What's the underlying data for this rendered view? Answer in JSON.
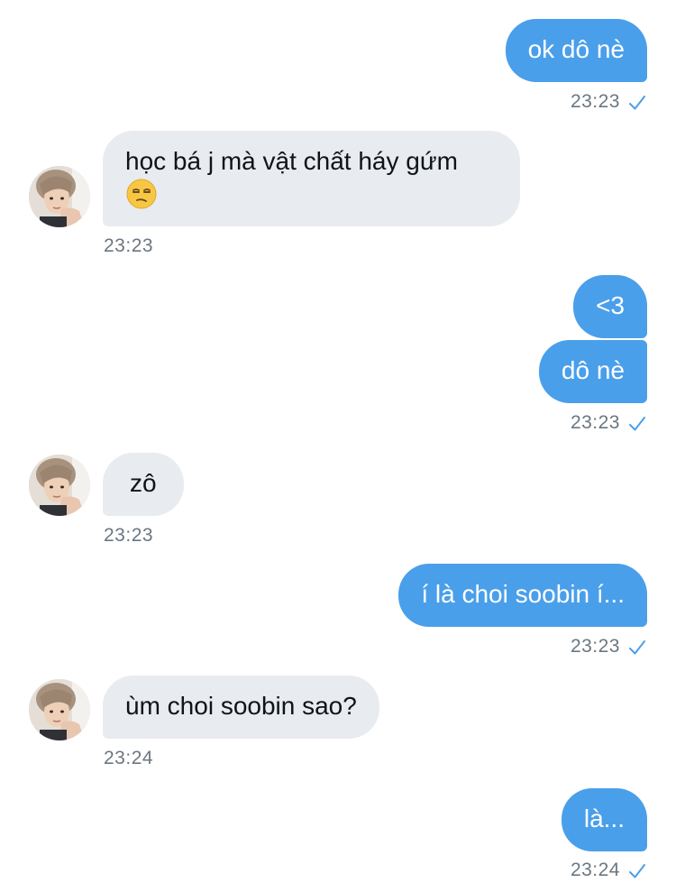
{
  "colors": {
    "outgoing_bubble": "#4a9fea",
    "incoming_bubble": "#e8ebef",
    "timestamp": "#6b7780",
    "read_check": "#4a9fea"
  },
  "messages": [
    {
      "id": "m1",
      "direction": "out",
      "text": "ok dô nè",
      "time": "23:23",
      "read_icon": "check-icon"
    },
    {
      "id": "m2",
      "direction": "in",
      "text": "học bá j mà vật chất háy gứm",
      "emoji": "unamused-face-emoji",
      "time": "23:23",
      "avatar": "avatar-photo"
    },
    {
      "id": "m3",
      "direction": "out",
      "text": "<3"
    },
    {
      "id": "m4",
      "direction": "out",
      "text": "dô nè",
      "time": "23:23",
      "read_icon": "check-icon"
    },
    {
      "id": "m5",
      "direction": "in",
      "text": "zô",
      "time": "23:23",
      "avatar": "avatar-photo"
    },
    {
      "id": "m6",
      "direction": "out",
      "text": "í là choi soobin í...",
      "time": "23:23",
      "read_icon": "check-icon"
    },
    {
      "id": "m7",
      "direction": "in",
      "text": "ùm choi soobin sao?",
      "time": "23:24",
      "avatar": "avatar-photo"
    },
    {
      "id": "m8",
      "direction": "out",
      "text": "là...",
      "time": "23:24",
      "read_icon": "check-icon"
    }
  ]
}
